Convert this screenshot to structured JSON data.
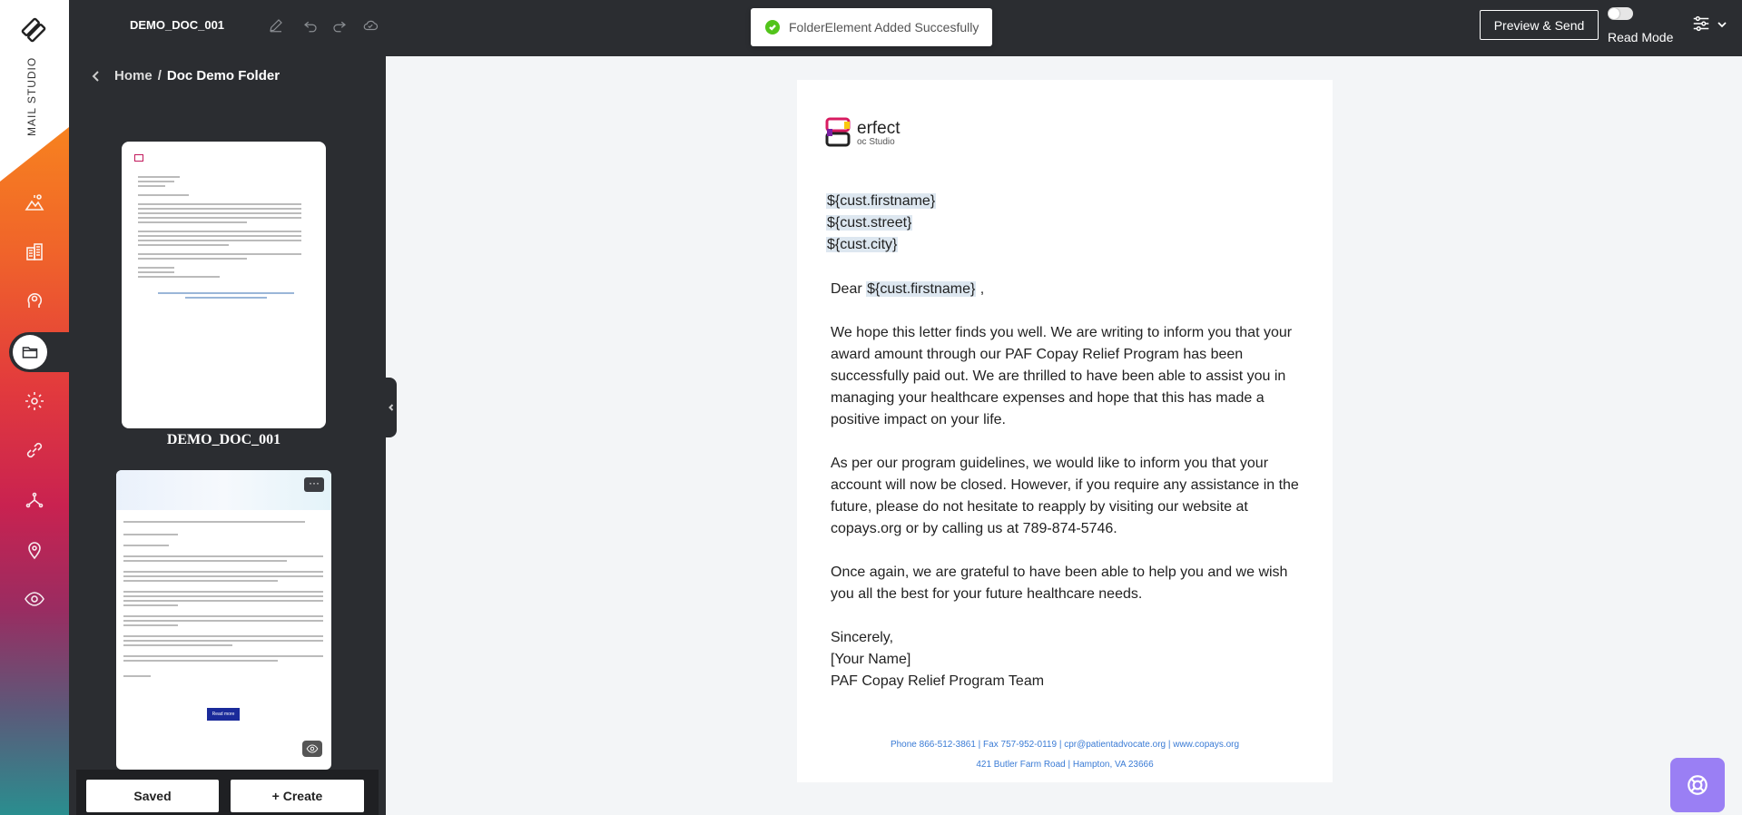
{
  "app": {
    "brand": "MAIL STUDIO"
  },
  "topbar": {
    "doc_name": "DEMO_DOC_001",
    "toast": "FolderElement Added Succesfully",
    "preview_label": "Preview & Send",
    "read_mode_label": "Read Mode",
    "read_mode_on": false
  },
  "breadcrumb": {
    "home": "Home",
    "separator": "/",
    "current": "Doc Demo Folder"
  },
  "thumbnails": [
    {
      "label": "DEMO_DOC_001"
    },
    {
      "label": "",
      "read_more": "Read more"
    }
  ],
  "panel_buttons": {
    "saved": "Saved",
    "create": "+ Create"
  },
  "document": {
    "logo_text": "erfect",
    "logo_sub": "oc Studio",
    "vars": [
      "${cust.firstname}",
      "${cust.street}",
      "${cust.city}"
    ],
    "salutation_prefix": "Dear",
    "salutation_var": "${cust.firstname}",
    "salutation_suffix": " ,",
    "p1": "We hope this letter finds you well. We are writing to inform you that your award amount through our PAF Copay Relief Program has been successfully paid out. We are thrilled to have been able to assist you in managing your healthcare expenses and hope that this has made a positive impact on your life.",
    "p2": "As per our program guidelines, we would like to inform you that your account will now be closed. However, if you require any assistance in the future, please do not hesitate to reapply by visiting our website at copays.org or by calling us at 789-874-5746.",
    "p3": "Once again, we are grateful to have been able to help you and we wish you all the best for your future healthcare needs.",
    "closing": "Sincerely,",
    "name": "[Your Name]",
    "team": "PAF Copay Relief Program Team",
    "footer_line1": "Phone 866-512-3861 | Fax 757-952-0119 | cpr@patientadvocate.org | www.copays.org",
    "footer_line2": "421 Butler Farm Road | Hampton, VA 23666"
  },
  "colors": {
    "accent": "#2b2d31",
    "toast_ok": "#52c41a",
    "link": "#3a7bd5",
    "help": "#9a7ff4",
    "variable_bg": "#dde7f0"
  }
}
